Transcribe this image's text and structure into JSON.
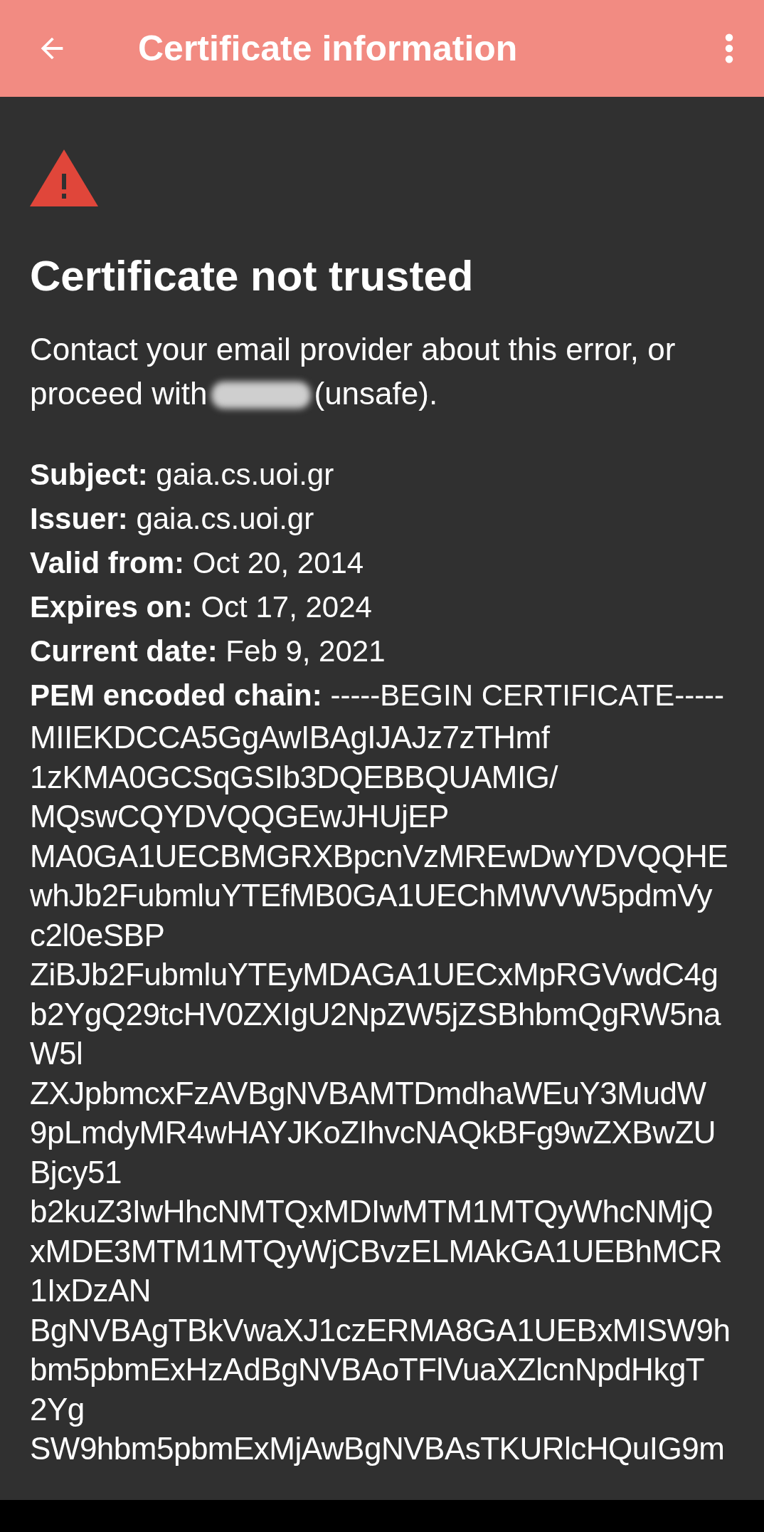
{
  "app_bar": {
    "title": "Certificate information"
  },
  "warning": {
    "title": "Certificate not trusted",
    "message_line": "Contact your email provider about this error, or",
    "message_before": "proceed with",
    "message_after": "(unsafe)."
  },
  "details": [
    {
      "text": "**Subject:** gaia.cs.uoi.gr"
    },
    {
      "text": "**Issuer:** gaia.cs.uoi.gr"
    },
    {
      "text": "**Valid from:** Oct 20, 2014"
    },
    {
      "text": "**Expires on:** Oct 17, 2024"
    },
    {
      "text": "**Current date:** Feb 9, 2021"
    },
    {
      "text": "**PEM encoded chain:** -----BEGIN CERTIFICATE-----"
    }
  ],
  "pem_lines": [
    "MIIEKDCCA5GgAwIBAgIJAJz7zTHmf",
    "1zKMA0GCSqGSIb3DQEBBQUAMIG/",
    "MQswCQYDVQQGEwJHUjEP",
    "MA0GA1UECBMGRXBpcnVzMREwDwYDVQQHE",
    "whJb2FubmluYTEfMB0GA1UEChMWVW5pdmVy",
    "c2l0eSBP",
    "ZiBJb2FubmluYTEyMDAGA1UECxMpRGVwdC4g",
    "b2YgQ29tcHV0ZXIgU2NpZW5jZSBhbmQgRW5na",
    "W5l",
    "ZXJpbmcxFzAVBgNVBAMTDmdhaWEuY3MudW",
    "9pLmdyMR4wHAYJKoZIhvcNAQkBFg9wZXBwZU",
    "Bjcy51",
    "b2kuZ3IwHhcNMTQxMDIwMTM1MTQyWhcNMjQ",
    "xMDE3MTM1MTQyWjCBvzELMAkGA1UEBhMCR",
    "1IxDzAN",
    "BgNVBAgTBkVwaXJ1czERMA8GA1UEBxMISW9h",
    "bm5pbmExHzAdBgNVBAoTFlVuaXZlcnNpdHkgT",
    "2Yg",
    "SW9hbm5pbmExMjAwBgNVBAsTKURlcHQuIG9m"
  ]
}
